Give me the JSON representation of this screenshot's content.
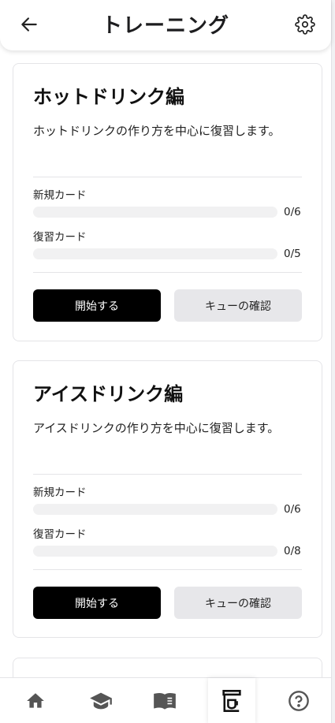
{
  "header": {
    "title": "トレーニング",
    "back_icon": "arrow-left-icon",
    "settings_icon": "gear-icon"
  },
  "cards": [
    {
      "title": "ホットドリンク編",
      "description": "ホットドリンクの作り方を中心に復習します。",
      "new_label": "新規カード",
      "new_progress": 0,
      "new_count": "0/6",
      "review_label": "復習カード",
      "review_progress": 0,
      "review_count": "0/5",
      "start_label": "開始する",
      "queue_label": "キューの確認"
    },
    {
      "title": "アイスドリンク編",
      "description": "アイスドリンクの作り方を中心に復習します。",
      "new_label": "新規カード",
      "new_progress": 0,
      "new_count": "0/6",
      "review_label": "復習カード",
      "review_progress": 0,
      "review_count": "0/8",
      "start_label": "開始する",
      "queue_label": "キューの確認"
    }
  ],
  "bottom_nav": {
    "items": [
      {
        "icon": "home-icon",
        "active": false
      },
      {
        "icon": "graduation-cap-icon",
        "active": false
      },
      {
        "icon": "book-icon",
        "active": false
      },
      {
        "icon": "coffee-machine-icon",
        "active": true
      },
      {
        "icon": "help-circle-icon",
        "active": false
      }
    ]
  },
  "colors": {
    "primary_button": "#000000",
    "secondary_button": "#e7e7ea",
    "progress_track": "#f1f1f2",
    "border": "#e4e4e7"
  }
}
